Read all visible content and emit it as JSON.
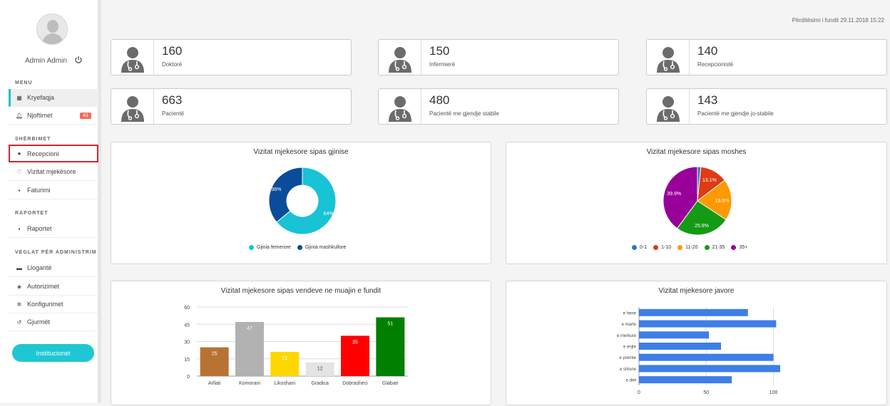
{
  "sidebar": {
    "user_name": "Admin Admin",
    "menu_title": "MENU",
    "menu_items": [
      {
        "label": "Kryefaqja",
        "icon": "dashboard-icon"
      },
      {
        "label": "Njoftimet",
        "icon": "bell-icon",
        "badge": "41"
      }
    ],
    "services_title": "SHËRBIMET",
    "services_items": [
      {
        "label": "Recepcioni",
        "icon": "info-circle-icon"
      },
      {
        "label": "Vizitat mjekësore",
        "icon": "stethoscope-icon"
      },
      {
        "label": "Faturimi",
        "icon": "invoice-icon"
      }
    ],
    "reports_title": "RAPORTET",
    "reports_items": [
      {
        "label": "Raportet",
        "icon": "report-icon"
      }
    ],
    "admin_title": "VEGLAT PËR ADMINISTRIM",
    "admin_items": [
      {
        "label": "Llogaritë",
        "icon": "account-card-icon"
      },
      {
        "label": "Autorizimet",
        "icon": "shield-icon"
      },
      {
        "label": "Konfigurimet",
        "icon": "gear-icon"
      },
      {
        "label": "Gjurmët",
        "icon": "history-icon"
      }
    ],
    "institutions_button": "Institucionet"
  },
  "header": {
    "last_updated": "Përditësimi i fundit 29.11.2018 15:22"
  },
  "stats": [
    {
      "value": "160",
      "label": "Doktorë"
    },
    {
      "value": "150",
      "label": "Infermierë"
    },
    {
      "value": "140",
      "label": "Recepcionistë"
    },
    {
      "value": "663",
      "label": "Pacientë"
    },
    {
      "value": "480",
      "label": "Pacientë me gjendje stabile"
    },
    {
      "value": "143",
      "label": "Pacientë me gjendje jo-stabile"
    }
  ],
  "colors": {
    "accent": "#1ec7d3",
    "badge": "#f26c5c",
    "highlight_border": "#d8232a",
    "icon_gray": "#666666"
  },
  "chart_data": [
    {
      "type": "pie",
      "title": "Vizitat mjekesore sipas gjinise",
      "donut": true,
      "categories": [
        "Gjinia femerore",
        "Gjinia mashkullore"
      ],
      "values": [
        64,
        36
      ],
      "labels": [
        "64%",
        "36%"
      ],
      "colors": [
        "#17c3d4",
        "#0b4c9a"
      ],
      "legend": "bottom"
    },
    {
      "type": "pie",
      "title": "Vizitat mjekesore sipas moshes",
      "categories": [
        "0-1",
        "1-10",
        "11-20",
        "21-35",
        "35+"
      ],
      "values": [
        1.6,
        13.1,
        19.6,
        25.8,
        39.9
      ],
      "labels": [
        "",
        "13.1%",
        "19.6%",
        "25.8%",
        "39.9%"
      ],
      "colors": [
        "#3373c4",
        "#dc3b14",
        "#ff9900",
        "#149a14",
        "#990099"
      ],
      "legend": "bottom"
    },
    {
      "type": "bar",
      "title": "Vizitat mjekesore sipas vendeve ne muajin e fundit",
      "categories": [
        "Arllati",
        "Komorani",
        "Likoshani",
        "Gradica",
        "Dobrasheci",
        "Glabari"
      ],
      "values": [
        25,
        47,
        21,
        12,
        35,
        51
      ],
      "colors": [
        "#b87333",
        "#b2b2b2",
        "#ffd700",
        "#e5e4e2",
        "#ff0000",
        "#008000"
      ],
      "ylim": [
        0,
        60
      ],
      "yticks": [
        "0",
        "15",
        "30",
        "45",
        "60"
      ],
      "grid": true
    },
    {
      "type": "bar",
      "orientation": "horizontal",
      "title": "Vizitat mjekesore javore",
      "categories": [
        "e hene",
        "e marte",
        "e merkure",
        "e enjte",
        "e premte",
        "e shtune",
        "e diel"
      ],
      "values": [
        81,
        102,
        52,
        61,
        100,
        105,
        69
      ],
      "color": "#3e7ee8",
      "xlim": [
        0,
        105
      ],
      "xticks": [
        "0",
        "50",
        "100"
      ],
      "grid": true
    }
  ]
}
